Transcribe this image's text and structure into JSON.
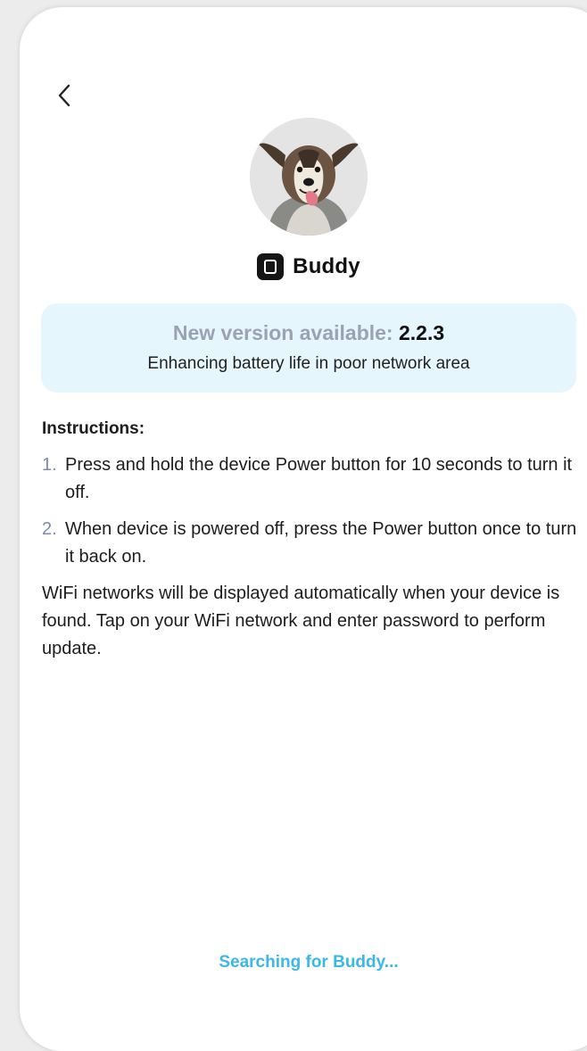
{
  "device": {
    "name": "Buddy"
  },
  "banner": {
    "label": "New version available:",
    "version": "2.2.3",
    "description": "Enhancing battery life in poor network area"
  },
  "instructions": {
    "title": "Instructions:",
    "steps": [
      {
        "number": "1.",
        "text": "Press and hold the device Power button for 10 seconds to turn it off."
      },
      {
        "number": "2.",
        "text": "When device is powered off, press the Power button once to turn it back on."
      }
    ],
    "note": "WiFi networks will be displayed automatically when your device is found. Tap on your WiFi network and enter password to perform update."
  },
  "status": {
    "text": "Searching for Buddy..."
  },
  "icons": {
    "back": "chevron-left-icon",
    "device": "device-icon",
    "avatar": "dog-avatar"
  },
  "colors": {
    "accent": "#3bb8e6",
    "banner_bg": "#e6f6fd",
    "muted_label": "#9aa2b4",
    "step_number": "#7f8bb0"
  }
}
